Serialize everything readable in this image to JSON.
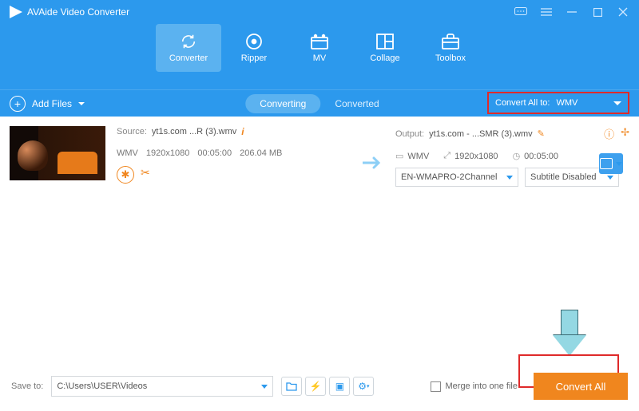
{
  "app": {
    "title": "AVAide Video Converter"
  },
  "tabs": [
    {
      "label": "Converter",
      "active": true
    },
    {
      "label": "Ripper",
      "active": false
    },
    {
      "label": "MV",
      "active": false
    },
    {
      "label": "Collage",
      "active": false
    },
    {
      "label": "Toolbox",
      "active": false
    }
  ],
  "toolbar": {
    "add_files": "Add Files",
    "converting": "Converting",
    "converted": "Converted",
    "convert_all_to_label": "Convert All to:",
    "convert_all_to_value": "WMV"
  },
  "file": {
    "source_label": "Source:",
    "source_name": "yt1s.com ...R (3).wmv",
    "format": "WMV",
    "resolution": "1920x1080",
    "duration": "00:05:00",
    "size": "206.04 MB",
    "output_label": "Output:",
    "output_name": "yt1s.com - ...SMR (3).wmv",
    "out_format": "WMV",
    "out_resolution": "1920x1080",
    "out_duration": "00:05:00",
    "audio_select": "EN-WMAPRO-2Channel",
    "subtitle_select": "Subtitle Disabled"
  },
  "footer": {
    "save_to_label": "Save to:",
    "save_path": "C:\\Users\\USER\\Videos",
    "merge_label": "Merge into one file",
    "convert_all": "Convert All"
  }
}
